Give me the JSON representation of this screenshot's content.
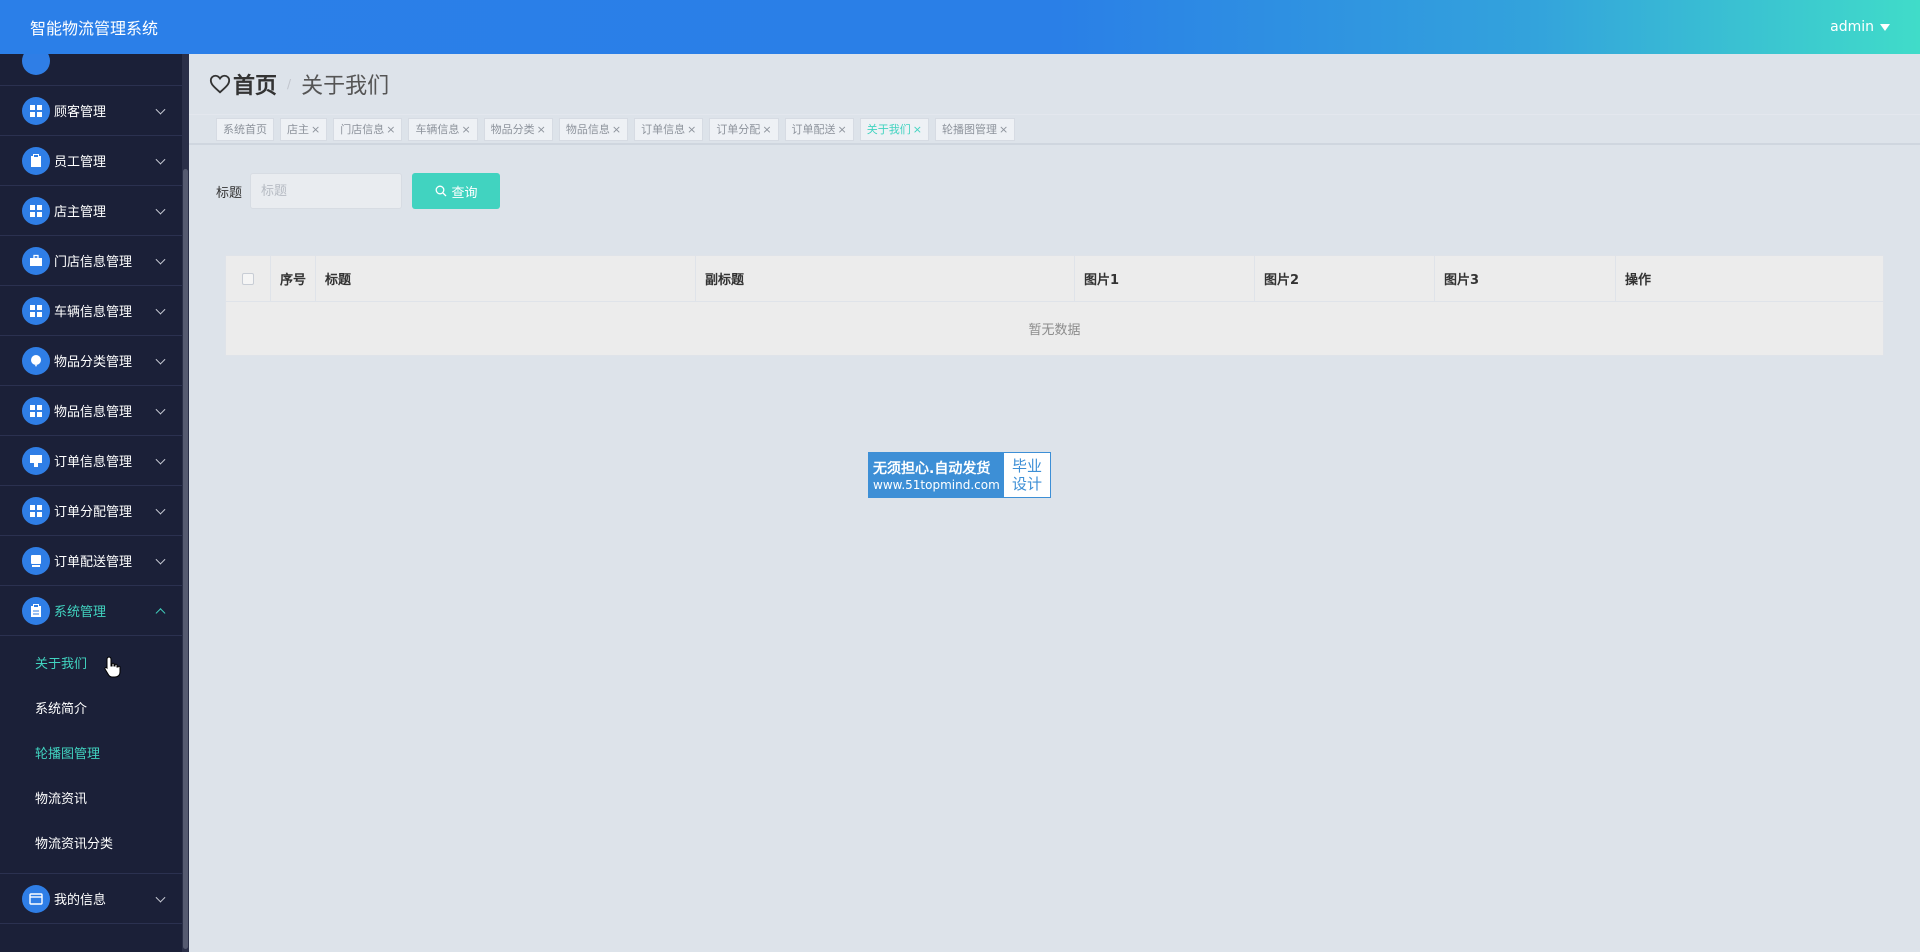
{
  "header": {
    "app_title": "智能物流管理系统",
    "user": "admin"
  },
  "sidebar": {
    "items": [
      {
        "label": "顾客管理",
        "icon": "grid-icon"
      },
      {
        "label": "员工管理",
        "icon": "clipboard-icon"
      },
      {
        "label": "店主管理",
        "icon": "grid-icon"
      },
      {
        "label": "门店信息管理",
        "icon": "briefcase-icon"
      },
      {
        "label": "车辆信息管理",
        "icon": "grid-icon"
      },
      {
        "label": "物品分类管理",
        "icon": "balloon-icon"
      },
      {
        "label": "物品信息管理",
        "icon": "grid-icon"
      },
      {
        "label": "订单信息管理",
        "icon": "monitor-icon"
      },
      {
        "label": "订单分配管理",
        "icon": "grid-icon"
      },
      {
        "label": "订单配送管理",
        "icon": "monitor-icon"
      },
      {
        "label": "系统管理",
        "icon": "clipboard-icon"
      }
    ],
    "submenu": [
      "关于我们",
      "系统简介",
      "轮播图管理",
      "物流资讯",
      "物流资讯分类"
    ],
    "last_item": {
      "label": "我的信息",
      "icon": "card-icon"
    }
  },
  "breadcrumb": {
    "home": "首页",
    "separator": "/",
    "current": "关于我们"
  },
  "tags": [
    "系统首页",
    "店主",
    "门店信息",
    "车辆信息",
    "物品分类",
    "物品信息",
    "订单信息",
    "订单分配",
    "订单配送",
    "关于我们",
    "轮播图管理"
  ],
  "search": {
    "label": "标题",
    "placeholder": "标题",
    "button": "查询"
  },
  "table": {
    "columns": [
      "序号",
      "标题",
      "副标题",
      "图片1",
      "图片2",
      "图片3",
      "操作"
    ],
    "empty_text": "暂无数据"
  },
  "badge": {
    "line1": "无须担心.自动发货",
    "line2": "www.51topmind.com",
    "right1": "毕业",
    "right2": "设计"
  },
  "colors": {
    "accent": "#41d3c0",
    "primary": "#2f7ee6",
    "sidebar_bg": "#1b2038"
  }
}
